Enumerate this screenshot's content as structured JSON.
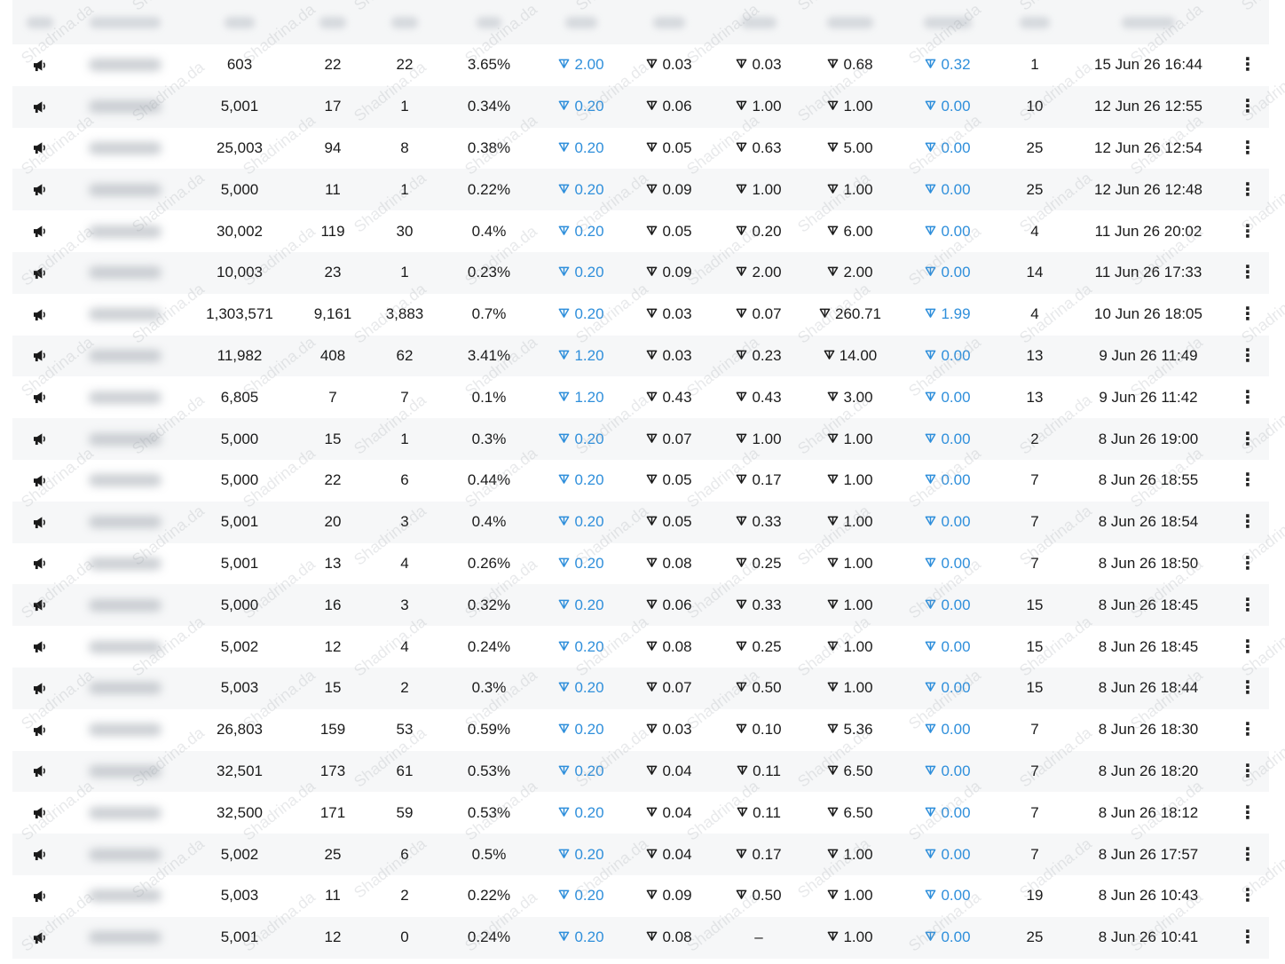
{
  "watermark": "Shadrina.da",
  "colors": {
    "accent": "#2f8fdb",
    "row_alt": "#f6f7f8"
  },
  "icons": {
    "campaign": "megaphone-icon",
    "currency": "ton-icon",
    "menu": "more-vertical-icon"
  },
  "rows": [
    {
      "v1": "603",
      "v2": "22",
      "v3": "22",
      "v4": "3.65%",
      "v5": "2.00",
      "v6": "0.03",
      "v7": "0.03",
      "v8": "0.68",
      "v9": "0.32",
      "v10": "1",
      "v11": "15 Jun 26 16:44"
    },
    {
      "v1": "5,001",
      "v2": "17",
      "v3": "1",
      "v4": "0.34%",
      "v5": "0.20",
      "v6": "0.06",
      "v7": "1.00",
      "v8": "1.00",
      "v9": "0.00",
      "v10": "10",
      "v11": "12 Jun 26 12:55"
    },
    {
      "v1": "25,003",
      "v2": "94",
      "v3": "8",
      "v4": "0.38%",
      "v5": "0.20",
      "v6": "0.05",
      "v7": "0.63",
      "v8": "5.00",
      "v9": "0.00",
      "v10": "25",
      "v11": "12 Jun 26 12:54"
    },
    {
      "v1": "5,000",
      "v2": "11",
      "v3": "1",
      "v4": "0.22%",
      "v5": "0.20",
      "v6": "0.09",
      "v7": "1.00",
      "v8": "1.00",
      "v9": "0.00",
      "v10": "25",
      "v11": "12 Jun 26 12:48"
    },
    {
      "v1": "30,002",
      "v2": "119",
      "v3": "30",
      "v4": "0.4%",
      "v5": "0.20",
      "v6": "0.05",
      "v7": "0.20",
      "v8": "6.00",
      "v9": "0.00",
      "v10": "4",
      "v11": "11 Jun 26 20:02"
    },
    {
      "v1": "10,003",
      "v2": "23",
      "v3": "1",
      "v4": "0.23%",
      "v5": "0.20",
      "v6": "0.09",
      "v7": "2.00",
      "v8": "2.00",
      "v9": "0.00",
      "v10": "14",
      "v11": "11 Jun 26 17:33"
    },
    {
      "v1": "1,303,571",
      "v2": "9,161",
      "v3": "3,883",
      "v4": "0.7%",
      "v5": "0.20",
      "v6": "0.03",
      "v7": "0.07",
      "v8": "260.71",
      "v9": "1.99",
      "v10": "4",
      "v11": "10 Jun 26 18:05"
    },
    {
      "v1": "11,982",
      "v2": "408",
      "v3": "62",
      "v4": "3.41%",
      "v5": "1.20",
      "v6": "0.03",
      "v7": "0.23",
      "v8": "14.00",
      "v9": "0.00",
      "v10": "13",
      "v11": "9 Jun 26 11:49"
    },
    {
      "v1": "6,805",
      "v2": "7",
      "v3": "7",
      "v4": "0.1%",
      "v5": "1.20",
      "v6": "0.43",
      "v7": "0.43",
      "v8": "3.00",
      "v9": "0.00",
      "v10": "13",
      "v11": "9 Jun 26 11:42"
    },
    {
      "v1": "5,000",
      "v2": "15",
      "v3": "1",
      "v4": "0.3%",
      "v5": "0.20",
      "v6": "0.07",
      "v7": "1.00",
      "v8": "1.00",
      "v9": "0.00",
      "v10": "2",
      "v11": "8 Jun 26 19:00"
    },
    {
      "v1": "5,000",
      "v2": "22",
      "v3": "6",
      "v4": "0.44%",
      "v5": "0.20",
      "v6": "0.05",
      "v7": "0.17",
      "v8": "1.00",
      "v9": "0.00",
      "v10": "7",
      "v11": "8 Jun 26 18:55"
    },
    {
      "v1": "5,001",
      "v2": "20",
      "v3": "3",
      "v4": "0.4%",
      "v5": "0.20",
      "v6": "0.05",
      "v7": "0.33",
      "v8": "1.00",
      "v9": "0.00",
      "v10": "7",
      "v11": "8 Jun 26 18:54"
    },
    {
      "v1": "5,001",
      "v2": "13",
      "v3": "4",
      "v4": "0.26%",
      "v5": "0.20",
      "v6": "0.08",
      "v7": "0.25",
      "v8": "1.00",
      "v9": "0.00",
      "v10": "7",
      "v11": "8 Jun 26 18:50"
    },
    {
      "v1": "5,000",
      "v2": "16",
      "v3": "3",
      "v4": "0.32%",
      "v5": "0.20",
      "v6": "0.06",
      "v7": "0.33",
      "v8": "1.00",
      "v9": "0.00",
      "v10": "15",
      "v11": "8 Jun 26 18:45"
    },
    {
      "v1": "5,002",
      "v2": "12",
      "v3": "4",
      "v4": "0.24%",
      "v5": "0.20",
      "v6": "0.08",
      "v7": "0.25",
      "v8": "1.00",
      "v9": "0.00",
      "v10": "15",
      "v11": "8 Jun 26 18:45"
    },
    {
      "v1": "5,003",
      "v2": "15",
      "v3": "2",
      "v4": "0.3%",
      "v5": "0.20",
      "v6": "0.07",
      "v7": "0.50",
      "v8": "1.00",
      "v9": "0.00",
      "v10": "15",
      "v11": "8 Jun 26 18:44"
    },
    {
      "v1": "26,803",
      "v2": "159",
      "v3": "53",
      "v4": "0.59%",
      "v5": "0.20",
      "v6": "0.03",
      "v7": "0.10",
      "v8": "5.36",
      "v9": "0.00",
      "v10": "7",
      "v11": "8 Jun 26 18:30"
    },
    {
      "v1": "32,501",
      "v2": "173",
      "v3": "61",
      "v4": "0.53%",
      "v5": "0.20",
      "v6": "0.04",
      "v7": "0.11",
      "v8": "6.50",
      "v9": "0.00",
      "v10": "7",
      "v11": "8 Jun 26 18:20"
    },
    {
      "v1": "32,500",
      "v2": "171",
      "v3": "59",
      "v4": "0.53%",
      "v5": "0.20",
      "v6": "0.04",
      "v7": "0.11",
      "v8": "6.50",
      "v9": "0.00",
      "v10": "7",
      "v11": "8 Jun 26 18:12"
    },
    {
      "v1": "5,002",
      "v2": "25",
      "v3": "6",
      "v4": "0.5%",
      "v5": "0.20",
      "v6": "0.04",
      "v7": "0.17",
      "v8": "1.00",
      "v9": "0.00",
      "v10": "7",
      "v11": "8 Jun 26 17:57"
    },
    {
      "v1": "5,003",
      "v2": "11",
      "v3": "2",
      "v4": "0.22%",
      "v5": "0.20",
      "v6": "0.09",
      "v7": "0.50",
      "v8": "1.00",
      "v9": "0.00",
      "v10": "19",
      "v11": "8 Jun 26 10:43"
    },
    {
      "v1": "5,001",
      "v2": "12",
      "v3": "0",
      "v4": "0.24%",
      "v5": "0.20",
      "v6": "0.08",
      "v7": "–",
      "v8": "1.00",
      "v9": "0.00",
      "v10": "25",
      "v11": "8 Jun 26 10:41"
    }
  ]
}
